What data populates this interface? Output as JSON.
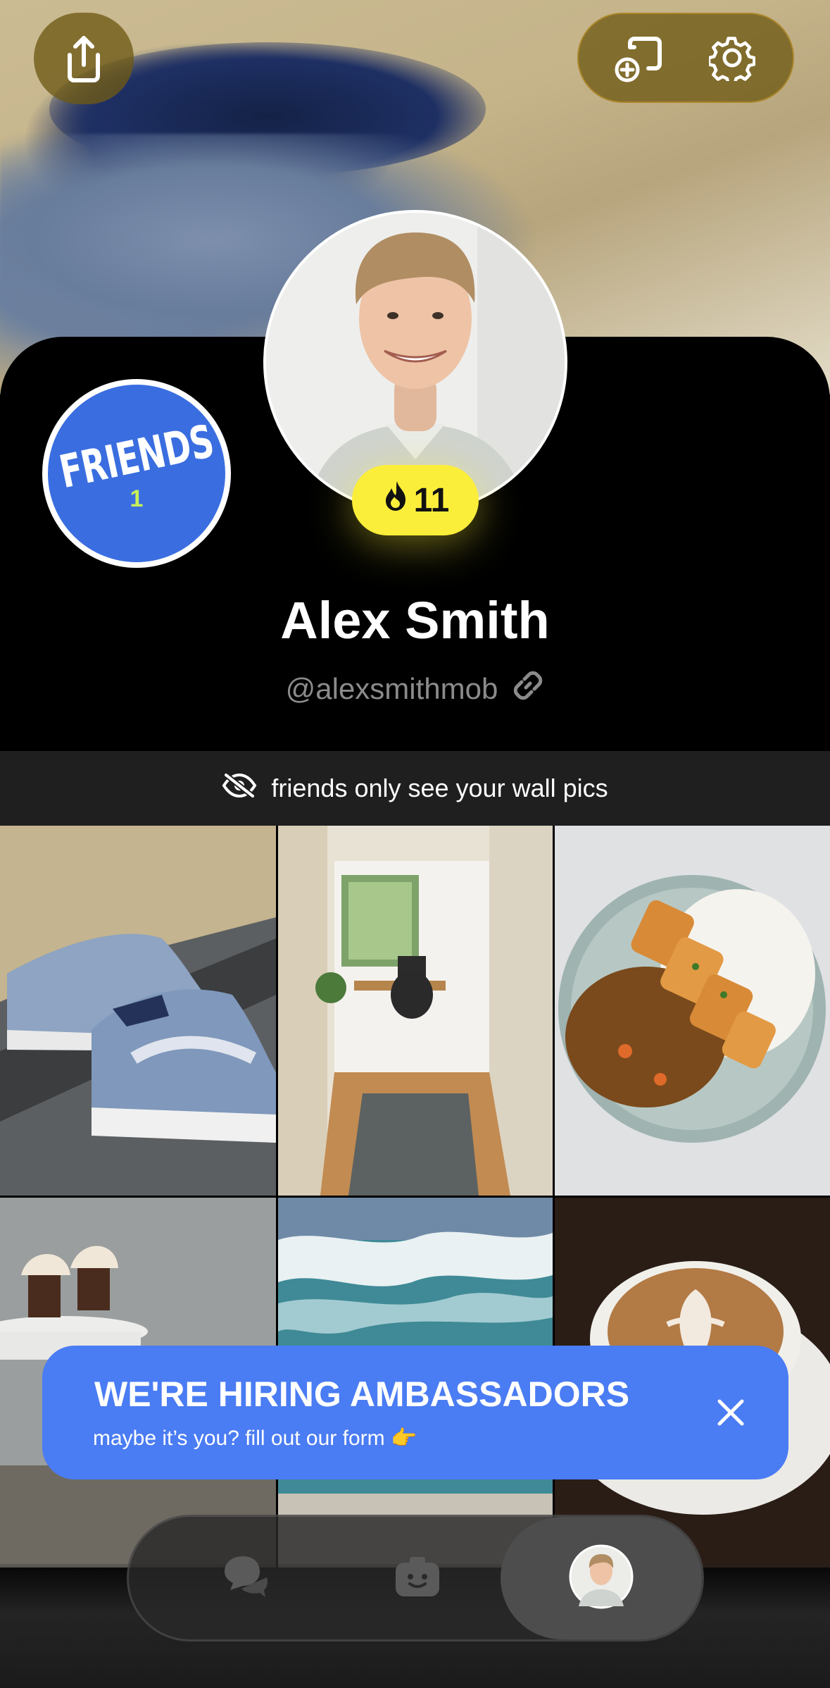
{
  "header": {
    "share_icon": "share-icon",
    "add_widget_icon": "add-widget-icon",
    "settings_icon": "gear-icon"
  },
  "profile": {
    "badge": {
      "label": "FRIENDS",
      "count": "1"
    },
    "streak": "11",
    "name": "Alex Smith",
    "handle": "@alexsmithmob",
    "link_icon": "link-icon"
  },
  "privacy": {
    "text": "friends only see your wall pics",
    "icon": "eye-off-icon"
  },
  "wall": {
    "photos": [
      "sneakers",
      "home-office",
      "katsu-curry",
      "cupcakes",
      "ocean-waves",
      "latte-art"
    ]
  },
  "promo": {
    "title": "WE'RE HIRING AMBASSADORS",
    "subtitle": "maybe it’s you? fill out our form 👉"
  },
  "tabbar": {
    "tabs": [
      "chat",
      "camera",
      "profile"
    ],
    "active": "profile"
  },
  "colors": {
    "streak": "#fbee3b",
    "promo": "#4a7cf3",
    "badge": "#3a6ee0"
  }
}
